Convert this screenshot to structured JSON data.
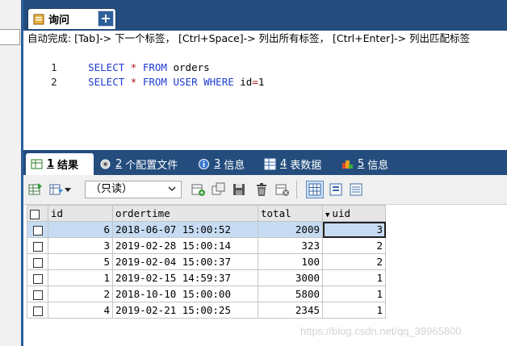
{
  "query_tab": {
    "label": "询问",
    "add_label": "+"
  },
  "editor": {
    "hint": "自动完成: [Tab]-> 下一个标签， [Ctrl+Space]-> 列出所有标签， [Ctrl+Enter]-> 列出匹配标签",
    "lines": [
      {
        "num": "1",
        "kw1": "SELECT",
        "op": "*",
        "kw2": "FROM",
        "rest": "orders"
      },
      {
        "num": "2",
        "kw1": "SELECT",
        "op": "*",
        "kw2": "FROM USER WHERE",
        "rest": "id",
        "op2": "=",
        "val": "1"
      }
    ]
  },
  "result_tabs": [
    {
      "num": "1",
      "label": "结果",
      "icon": "result-grid-icon",
      "active": true
    },
    {
      "num": "2",
      "label": "个配置文件",
      "icon": "profile-icon"
    },
    {
      "num": "3",
      "label": "信息",
      "icon": "info-icon"
    },
    {
      "num": "4",
      "label": "表数据",
      "icon": "table-data-icon"
    },
    {
      "num": "5",
      "label": "信息",
      "icon": "history-icon"
    }
  ],
  "toolbar": {
    "mode": "（只读）"
  },
  "grid": {
    "columns": [
      "id",
      "ordertime",
      "total",
      "uid"
    ],
    "sorted_column": "uid",
    "rows": [
      {
        "id": "6",
        "ordertime": "2018-06-07 15:00:52",
        "total": "2009",
        "uid": "3"
      },
      {
        "id": "3",
        "ordertime": "2019-02-28 15:00:14",
        "total": "323",
        "uid": "2"
      },
      {
        "id": "5",
        "ordertime": "2019-02-04 15:00:37",
        "total": "100",
        "uid": "2"
      },
      {
        "id": "1",
        "ordertime": "2019-02-15 14:59:37",
        "total": "3000",
        "uid": "1"
      },
      {
        "id": "2",
        "ordertime": "2018-10-10 15:00:00",
        "total": "5800",
        "uid": "1"
      },
      {
        "id": "4",
        "ordertime": "2019-02-21 15:00:25",
        "total": "2345",
        "uid": "1"
      }
    ]
  },
  "watermark": "https://blog.csdn.net/qq_39965800",
  "colors": {
    "tab_bar": "#244d7e",
    "selected_row": "#c7dcf3",
    "keyword": "#1e3cd0",
    "operator": "#b21818"
  }
}
